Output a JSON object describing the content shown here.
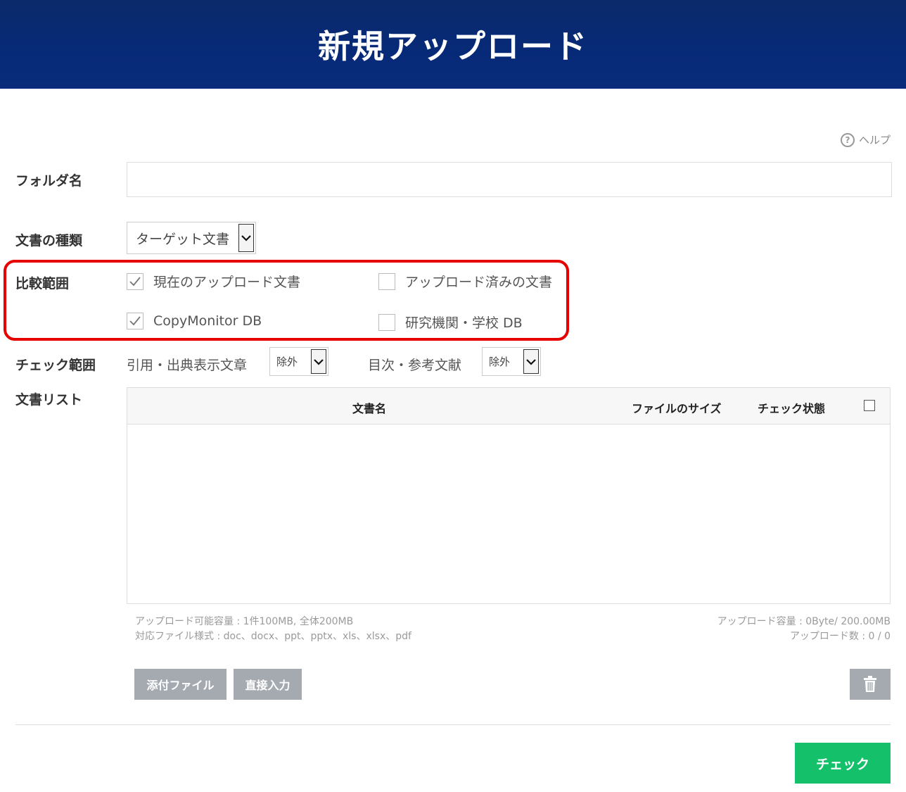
{
  "header": {
    "title": "新規アップロード"
  },
  "help": {
    "icon": "help-circle-icon",
    "label": "ヘルプ"
  },
  "form": {
    "folder_label": "フォルダ名",
    "folder_value": "",
    "doc_type_label": "文書の種類",
    "doc_type_value": "ターゲット文書",
    "compare_label": "比較範囲",
    "compare_options": [
      {
        "label": "現在のアップロード文書",
        "checked": true
      },
      {
        "label": "アップロード済みの文書",
        "checked": false
      },
      {
        "label": "CopyMonitor DB",
        "checked": true
      },
      {
        "label": "研究機関・学校 DB",
        "checked": false
      }
    ],
    "check_scope_label": "チェック範囲",
    "scope_citation_label": "引用・出典表示文章",
    "scope_citation_value": "除外",
    "scope_toc_label": "目次・参考文献",
    "scope_toc_value": "除外",
    "doclist_label": "文書リスト"
  },
  "table": {
    "columns": [
      "文書名",
      "ファイルのサイズ",
      "チェック状態"
    ]
  },
  "info": {
    "capacity_line": "アップロード可能容量 : 1件100MB, 全体200MB",
    "formats_line": "対応ファイル様式 : doc、docx、ppt、pptx、xls、xlsx、pdf",
    "usage_line": "アップロード容量 : 0Byte/ 200.00MB",
    "count_line": "アップロード数 : 0 / 0"
  },
  "buttons": {
    "attach": "添付ファイル",
    "direct_input": "直接入力",
    "check": "チェック"
  },
  "colors": {
    "header": "#072a78",
    "accent_green": "#15c06a",
    "highlight_red": "#e60000",
    "button_gray": "#a5a9b0"
  }
}
